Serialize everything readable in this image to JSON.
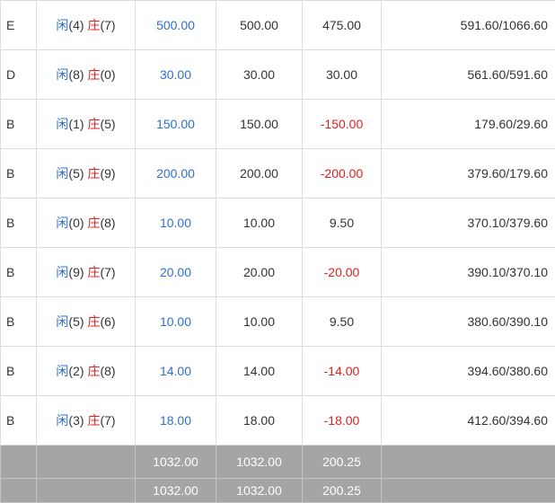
{
  "rows": [
    {
      "code": "E",
      "player_label": "闲",
      "player_score": "(4)",
      "banker_label": "庄",
      "banker_score": "(7)",
      "bet": "500.00",
      "valid": "500.00",
      "win": "475.00",
      "win_negative": false,
      "balance": "591.60/1066.60"
    },
    {
      "code": "D",
      "player_label": "闲",
      "player_score": "(8)",
      "banker_label": "庄",
      "banker_score": "(0)",
      "bet": "30.00",
      "valid": "30.00",
      "win": "30.00",
      "win_negative": false,
      "balance": "561.60/591.60"
    },
    {
      "code": "B",
      "player_label": "闲",
      "player_score": "(1)",
      "banker_label": "庄",
      "banker_score": "(5)",
      "bet": "150.00",
      "valid": "150.00",
      "win": "-150.00",
      "win_negative": true,
      "balance": "179.60/29.60"
    },
    {
      "code": "B",
      "player_label": "闲",
      "player_score": "(5)",
      "banker_label": "庄",
      "banker_score": "(9)",
      "bet": "200.00",
      "valid": "200.00",
      "win": "-200.00",
      "win_negative": true,
      "balance": "379.60/179.60"
    },
    {
      "code": "B",
      "player_label": "闲",
      "player_score": "(0)",
      "banker_label": "庄",
      "banker_score": "(8)",
      "bet": "10.00",
      "valid": "10.00",
      "win": "9.50",
      "win_negative": false,
      "balance": "370.10/379.60"
    },
    {
      "code": "B",
      "player_label": "闲",
      "player_score": "(9)",
      "banker_label": "庄",
      "banker_score": "(7)",
      "bet": "20.00",
      "valid": "20.00",
      "win": "-20.00",
      "win_negative": true,
      "balance": "390.10/370.10"
    },
    {
      "code": "B",
      "player_label": "闲",
      "player_score": "(5)",
      "banker_label": "庄",
      "banker_score": "(6)",
      "bet": "10.00",
      "valid": "10.00",
      "win": "9.50",
      "win_negative": false,
      "balance": "380.60/390.10"
    },
    {
      "code": "B",
      "player_label": "闲",
      "player_score": "(2)",
      "banker_label": "庄",
      "banker_score": "(8)",
      "bet": "14.00",
      "valid": "14.00",
      "win": "-14.00",
      "win_negative": true,
      "balance": "394.60/380.60"
    },
    {
      "code": "B",
      "player_label": "闲",
      "player_score": "(3)",
      "banker_label": "庄",
      "banker_score": "(7)",
      "bet": "18.00",
      "valid": "18.00",
      "win": "-18.00",
      "win_negative": true,
      "balance": "412.60/394.60"
    }
  ],
  "totals": [
    {
      "bet": "1032.00",
      "valid": "1032.00",
      "win": "200.25"
    },
    {
      "bet": "1032.00",
      "valid": "1032.00",
      "win": "200.25"
    }
  ],
  "colors": {
    "player": "#2d6fcf",
    "banker": "#e02020",
    "negative": "#e02020",
    "total_bg": "#a5a5a5"
  }
}
